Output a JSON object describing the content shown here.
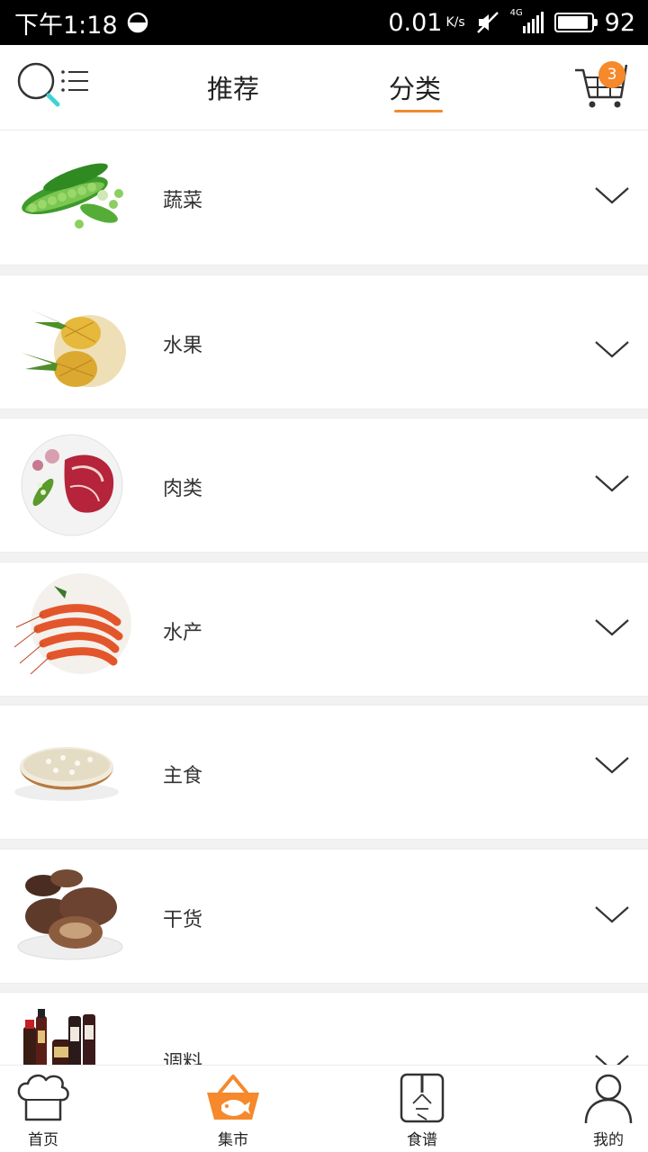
{
  "status_bar": {
    "time": "下午1:18",
    "net_speed": "0.01",
    "net_unit": "K/s",
    "signal": "4G",
    "battery": "92",
    "battery_level": 0.92
  },
  "top_nav": {
    "tabs": [
      {
        "label": "推荐",
        "active": false
      },
      {
        "label": "分类",
        "active": true
      }
    ],
    "cart_count": "3",
    "accent_color": "#f08b2c"
  },
  "categories": [
    {
      "label": "蔬菜",
      "image": "peas-icon"
    },
    {
      "label": "水果",
      "image": "pineapple-icon"
    },
    {
      "label": "肉类",
      "image": "steak-icon"
    },
    {
      "label": "水产",
      "image": "shrimp-icon"
    },
    {
      "label": "主食",
      "image": "rice-bowl-icon"
    },
    {
      "label": "干货",
      "image": "mushroom-icon"
    },
    {
      "label": "调料",
      "image": "sauce-bottles-icon"
    }
  ],
  "bottom_bar": {
    "items": [
      {
        "label": "首页",
        "icon": "chef-hat-icon",
        "active": false
      },
      {
        "label": "集市",
        "icon": "market-basket-icon",
        "active": true
      },
      {
        "label": "食谱",
        "icon": "recipe-book-icon",
        "active": false
      },
      {
        "label": "我的",
        "icon": "user-icon",
        "active": false
      }
    ]
  }
}
